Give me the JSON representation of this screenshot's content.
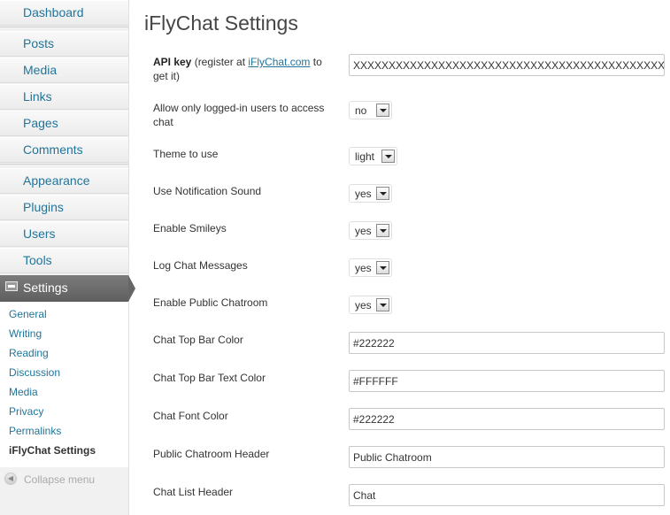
{
  "sidebar": {
    "items": [
      {
        "label": "Dashboard"
      },
      {
        "label": "Posts"
      },
      {
        "label": "Media"
      },
      {
        "label": "Links"
      },
      {
        "label": "Pages"
      },
      {
        "label": "Comments"
      },
      {
        "label": "Appearance"
      },
      {
        "label": "Plugins"
      },
      {
        "label": "Users"
      },
      {
        "label": "Tools"
      }
    ],
    "active": {
      "label": "Settings",
      "icon": "settings-icon"
    },
    "submenu": [
      {
        "label": "General"
      },
      {
        "label": "Writing"
      },
      {
        "label": "Reading"
      },
      {
        "label": "Discussion"
      },
      {
        "label": "Media"
      },
      {
        "label": "Privacy"
      },
      {
        "label": "Permalinks"
      },
      {
        "label": "iFlyChat Settings",
        "current": true
      }
    ],
    "collapse_label": "Collapse menu"
  },
  "main": {
    "title": "iFlyChat Settings",
    "api_key": {
      "label_strong": "API key",
      "label_pre": " (register at ",
      "link_text": "iFlyChat.com",
      "label_post": " to get it)",
      "value": "XXXXXXXXXXXXXXXXXXXXXXXXXXXXXXXXXXXXXXXXXXXXXX"
    },
    "selects": [
      {
        "label": "Allow only logged-in users to access chat",
        "value": "no"
      },
      {
        "label": "Theme to use",
        "value": "light"
      },
      {
        "label": "Use Notification Sound",
        "value": "yes"
      },
      {
        "label": "Enable Smileys",
        "value": "yes"
      },
      {
        "label": "Log Chat Messages",
        "value": "yes"
      },
      {
        "label": "Enable Public Chatroom",
        "value": "yes"
      }
    ],
    "texts": [
      {
        "label": "Chat Top Bar Color",
        "value": "#222222"
      },
      {
        "label": "Chat Top Bar Text Color",
        "value": "#FFFFFF"
      },
      {
        "label": "Chat Font Color",
        "value": "#222222"
      },
      {
        "label": "Public Chatroom Header",
        "value": "Public Chatroom"
      },
      {
        "label": "Chat List Header",
        "value": "Chat"
      }
    ]
  },
  "colors": {
    "link": "#21759b",
    "active_menu": "#666666",
    "title": "#464646"
  }
}
